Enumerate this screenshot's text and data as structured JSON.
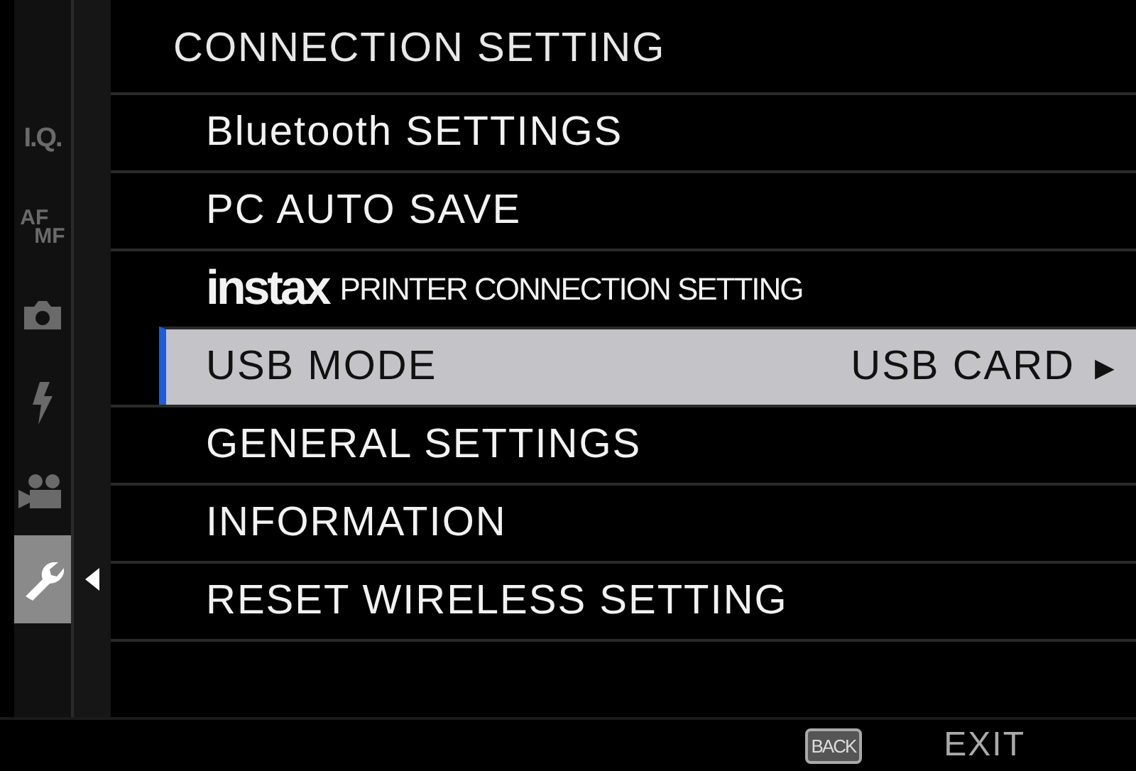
{
  "title": "CONNECTION SETTING",
  "sidebar": [
    {
      "kind": "text",
      "label": "I.Q.",
      "selected": false
    },
    {
      "kind": "afmf",
      "label": "AF",
      "label_2": "MF",
      "selected": false
    },
    {
      "kind": "camera",
      "selected": false
    },
    {
      "kind": "flash",
      "selected": false
    },
    {
      "kind": "video",
      "selected": false
    },
    {
      "kind": "wrench",
      "selected": true
    }
  ],
  "items": [
    {
      "label": "Bluetooth SETTINGS",
      "selected": false
    },
    {
      "label": "PC AUTO SAVE",
      "selected": false
    },
    {
      "logo": "instax",
      "label": "PRINTER CONNECTION SETTING",
      "selected": false
    },
    {
      "label": "USB MODE",
      "value": "USB CARD",
      "arrow": "▶",
      "selected": true
    },
    {
      "label": "GENERAL SETTINGS",
      "selected": false
    },
    {
      "label": "INFORMATION",
      "selected": false
    },
    {
      "label": "RESET WIRELESS SETTING",
      "selected": false
    }
  ],
  "footer": {
    "key": "BACK",
    "action": "EXIT"
  }
}
